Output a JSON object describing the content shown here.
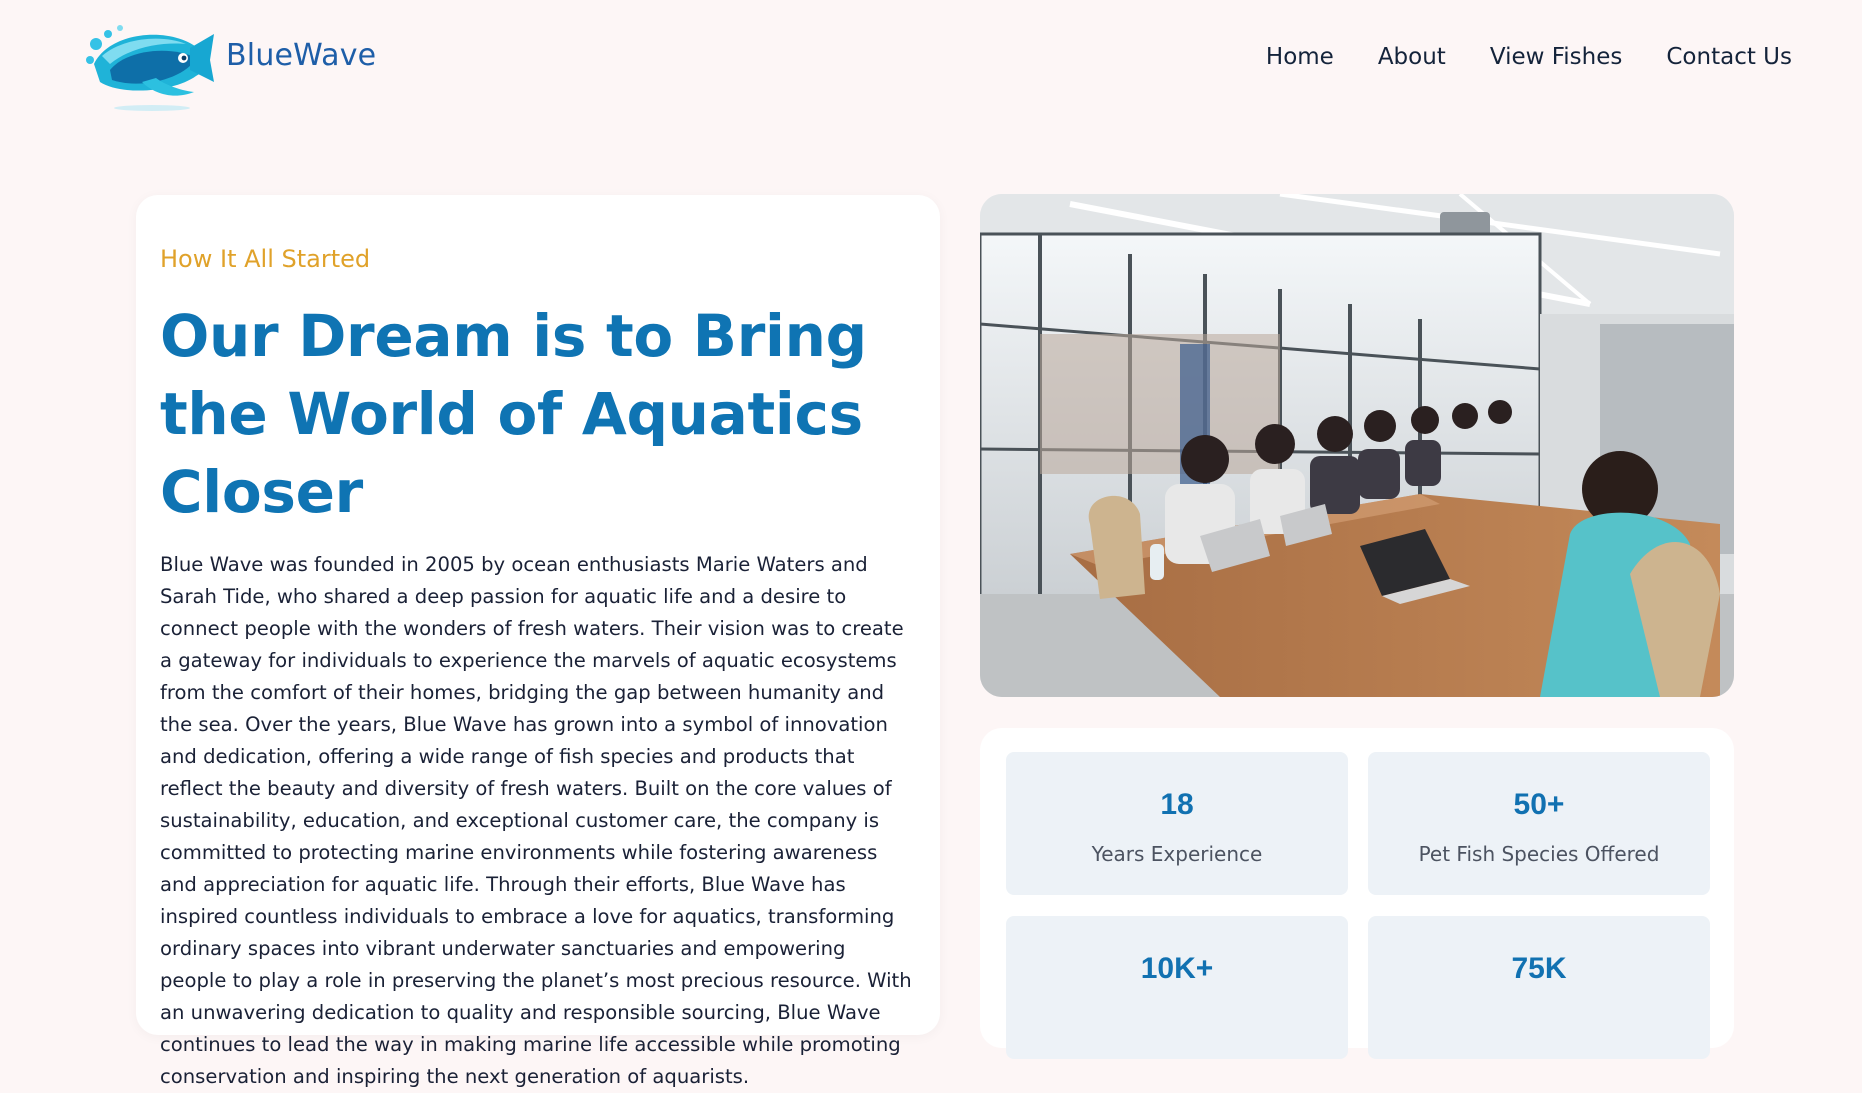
{
  "brand": {
    "name": "BlueWave",
    "logo_icon": "fish-logo-icon"
  },
  "nav": {
    "items": [
      {
        "label": "Home"
      },
      {
        "label": "About"
      },
      {
        "label": "View Fishes"
      },
      {
        "label": "Contact Us"
      }
    ]
  },
  "story": {
    "eyebrow": "How It All Started",
    "headline": "Our Dream is to Bring the World of Aquatics Closer",
    "body": "Blue Wave was founded in 2005 by ocean enthusiasts Marie Waters and Sarah Tide, who shared a deep passion for aquatic life and a desire to connect people with the wonders of fresh waters. Their vision was to create a gateway for individuals to experience the marvels of aquatic ecosystems from the comfort of their homes, bridging the gap between humanity and the sea. Over the years, Blue Wave has grown into a symbol of innovation and dedication, offering a wide range of fish species and products that reflect the beauty and diversity of fresh waters. Built on the core values of sustainability, education, and exceptional customer care, the company is committed to protecting marine environments while fostering awareness and appreciation for aquatic life. Through their efforts, Blue Wave has inspired countless individuals to embrace a love for aquatics, transforming ordinary spaces into vibrant underwater sanctuaries and empowering people to play a role in preserving the planet’s most precious resource. With an unwavering dedication to quality and responsible sourcing, Blue Wave continues to lead the way in making marine life accessible while promoting conservation and inspiring the next generation of aquarists."
  },
  "photo": {
    "subject": "team-meeting-photo"
  },
  "stats": [
    {
      "value": "18",
      "label": "Years Experience"
    },
    {
      "value": "50+",
      "label": "Pet Fish Species Offered"
    },
    {
      "value": "10K+",
      "label": ""
    },
    {
      "value": "75K",
      "label": ""
    }
  ],
  "colors": {
    "page_background": "#fdf6f6",
    "brand_blue": "#1e5ea8",
    "headline_blue": "#0f74b3",
    "eyebrow_gold": "#e0a22a",
    "stat_tile": "#edf2f7"
  }
}
